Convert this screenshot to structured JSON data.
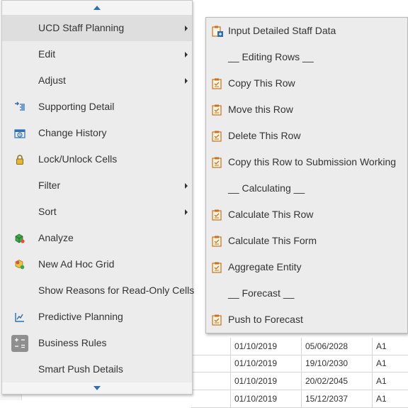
{
  "main_menu": {
    "items": [
      {
        "label": "UCD Staff Planning",
        "icon": "",
        "has_submenu": true
      },
      {
        "label": "Edit",
        "icon": "",
        "has_submenu": true
      },
      {
        "label": "Adjust",
        "icon": "",
        "has_submenu": true
      },
      {
        "label": "Supporting Detail",
        "icon": "supporting-detail-icon",
        "has_submenu": false
      },
      {
        "label": "Change History",
        "icon": "change-history-icon",
        "has_submenu": false
      },
      {
        "label": "Lock/Unlock Cells",
        "icon": "lock-icon",
        "has_submenu": false
      },
      {
        "label": "Filter",
        "icon": "",
        "has_submenu": true
      },
      {
        "label": "Sort",
        "icon": "",
        "has_submenu": true
      },
      {
        "label": "Analyze",
        "icon": "analyze-cube-icon",
        "has_submenu": false
      },
      {
        "label": "New Ad Hoc Grid",
        "icon": "ad-hoc-grid-icon",
        "has_submenu": false
      },
      {
        "label": "Show Reasons for Read-Only Cells",
        "icon": "",
        "has_submenu": false
      },
      {
        "label": "Predictive Planning",
        "icon": "predictive-chart-icon",
        "has_submenu": false
      },
      {
        "label": "Business Rules",
        "icon": "calculator-icon",
        "has_submenu": false
      },
      {
        "label": "Smart Push Details",
        "icon": "",
        "has_submenu": false
      }
    ]
  },
  "submenu": {
    "items": [
      {
        "label": "Input Detailed Staff Data",
        "icon": "form-link-icon"
      },
      {
        "label": "__ Editing Rows __",
        "icon": ""
      },
      {
        "label": "Copy This Row",
        "icon": "rule-form-icon"
      },
      {
        "label": "Move this Row",
        "icon": "rule-form-icon"
      },
      {
        "label": "Delete This Row",
        "icon": "rule-form-icon"
      },
      {
        "label": "Copy this Row to Submission Working",
        "icon": "rule-form-icon"
      },
      {
        "label": "__ Calculating __",
        "icon": ""
      },
      {
        "label": "Calculate This Row",
        "icon": "rule-form-icon"
      },
      {
        "label": "Calculate This Form",
        "icon": "rule-form-icon"
      },
      {
        "label": "Aggregate Entity",
        "icon": "rule-form-icon"
      },
      {
        "label": "__ Forecast __",
        "icon": ""
      },
      {
        "label": "Push to Forecast",
        "icon": "rule-form-icon"
      }
    ]
  },
  "background_grid": {
    "rows": [
      [
        "01/10/2019",
        "05/06/2028",
        "A1"
      ],
      [
        "01/10/2019",
        "19/10/2030",
        "A1"
      ],
      [
        "01/10/2019",
        "20/02/2045",
        "A1"
      ],
      [
        "01/10/2019",
        "15/12/2037",
        "A1"
      ]
    ]
  },
  "colors": {
    "menu_bg": "#ececec",
    "highlight": "#dedede",
    "accent_blue": "#2b6fb5",
    "form_icon_orange": "#c9711f"
  }
}
